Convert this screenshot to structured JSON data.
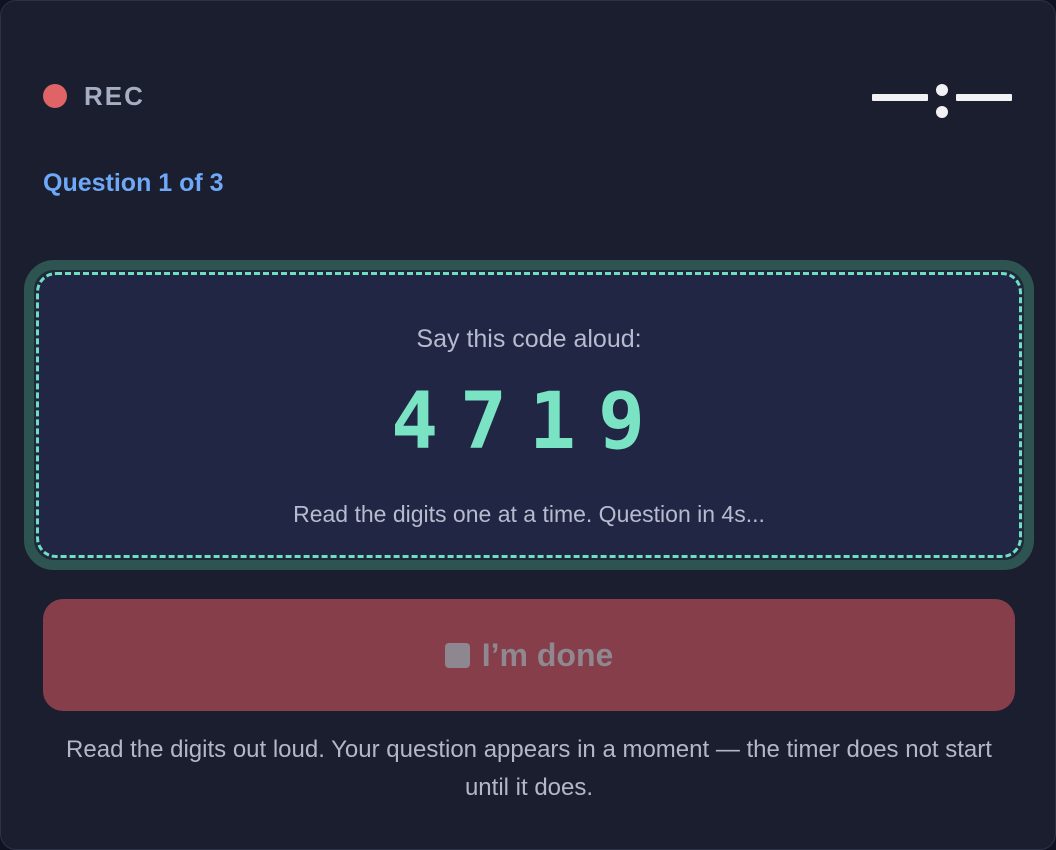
{
  "header": {
    "rec_label": "REC",
    "rec_color": "#e06368"
  },
  "question": {
    "counter": "Question 1 of 3"
  },
  "code_card": {
    "title": "Say this code aloud:",
    "digits": "4719",
    "hint": "Read the digits one at a time. Question in 4s..."
  },
  "done_button": {
    "label": "I’m done",
    "icon": "stop-icon"
  },
  "footer": {
    "text": "Read the digits out loud. Your question appears in a moment — the timer does not start until it does."
  },
  "icons": {
    "signal": "signal-icon"
  },
  "colors": {
    "accent_teal": "#7ae3c3",
    "accent_blue": "#6ea8f7",
    "button_red": "#853e4a"
  }
}
